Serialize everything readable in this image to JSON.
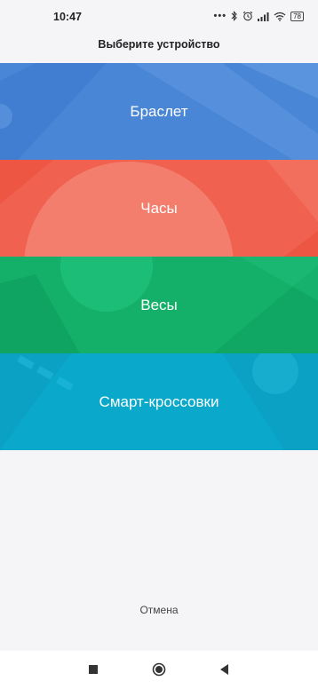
{
  "status_bar": {
    "time": "10:47",
    "dots": "•••",
    "battery": "78"
  },
  "title": "Выберите устройство",
  "devices": [
    {
      "label": "Браслет",
      "color": "#4a86d6"
    },
    {
      "label": "Часы",
      "color": "#f0614f"
    },
    {
      "label": "Весы",
      "color": "#14b06a"
    },
    {
      "label": "Смарт-кроссовки",
      "color": "#0aa9cb"
    }
  ],
  "cancel_label": "Отмена",
  "nav": {
    "icons": [
      "square-icon",
      "home-circle-icon",
      "back-triangle-icon"
    ]
  }
}
